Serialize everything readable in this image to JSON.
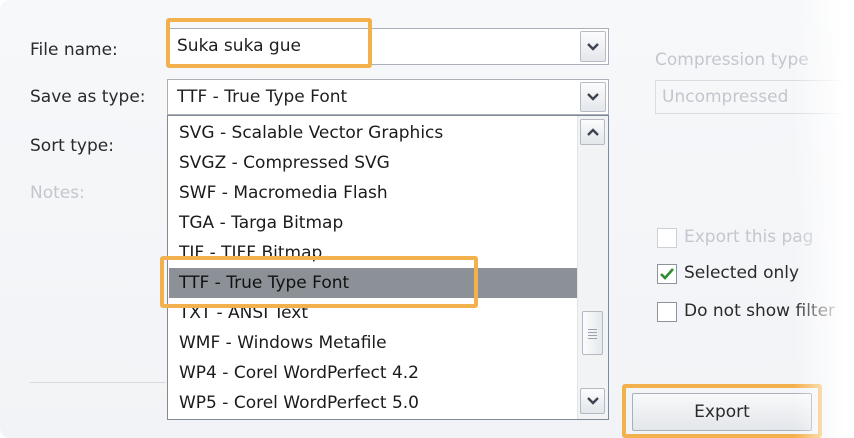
{
  "form": {
    "file_name_label": "File name:",
    "file_name_value": "Suka suka gue",
    "save_as_type_label": "Save as type:",
    "save_as_type_value": "TTF - True Type Font",
    "sort_type_label": "Sort type:",
    "notes_label": "Notes:"
  },
  "type_list": {
    "items": [
      "SVG - Scalable Vector Graphics",
      "SVGZ - Compressed SVG",
      "SWF - Macromedia Flash",
      "TGA - Targa Bitmap",
      "TIF - TIFF Bitmap",
      "TTF - True Type Font",
      "TXT - ANSI Text",
      "WMF - Windows Metafile",
      "WP4 - Corel WordPerfect 4.2",
      "WP5 - Corel WordPerfect 5.0"
    ],
    "selected": "TTF - True Type Font"
  },
  "options": {
    "compression_type_label": "Compression type",
    "compression_value": "Uncompressed",
    "export_this_page_label": "Export this pag",
    "selected_only_label": "Selected only",
    "selected_only_checked": true,
    "do_not_show_filter_label": "Do not show filter"
  },
  "buttons": {
    "export_label": "Export"
  },
  "colors": {
    "highlight": "#f3b14d",
    "selected_row": "#8c9198",
    "check_green": "#2e8b2e"
  }
}
